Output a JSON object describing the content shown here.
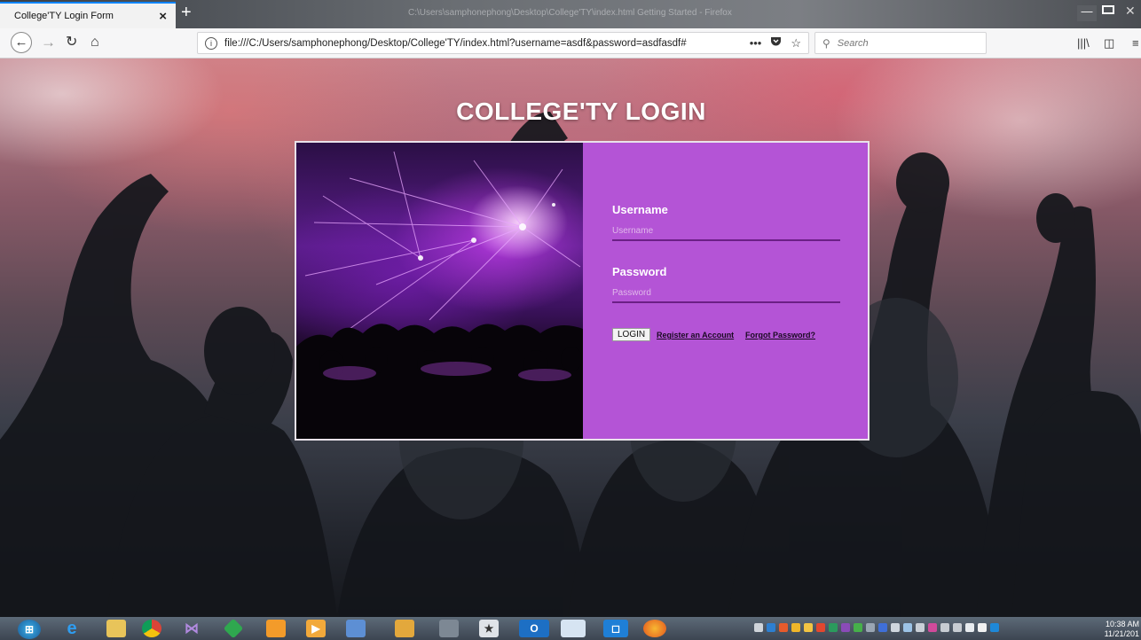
{
  "browser": {
    "tab_title": "College'TY Login Form",
    "tab_close": "×",
    "new_tab": "+",
    "window_title": "C:\\Users\\samphonephong\\Desktop\\College'TY\\index.html Getting Started - Firefox",
    "url": "file:///C:/Users/samphonephong/Desktop/College'TY/index.html?username=asdf&password=asdfasdf#",
    "url_actions": [
      "•••",
      "pocket-icon",
      "bookmark-star-icon"
    ],
    "search_placeholder": "Search",
    "nav_icons": [
      "back-arrow-icon",
      "forward-arrow-icon",
      "reload-icon",
      "home-icon"
    ],
    "tool_icons": [
      "library-icon",
      "sidebar-icon",
      "menu-icon"
    ]
  },
  "page": {
    "heading": "COLLEGE'TY LOGIN",
    "form": {
      "username_label": "Username",
      "username_placeholder": "Username",
      "password_label": "Password",
      "password_placeholder": "Password",
      "login_button": "LOGIN",
      "register_link": "Register an Account",
      "forgot_link": "Forgot Password?"
    },
    "colors": {
      "form_background": "#b454d6",
      "input_underline": "#6b1f86"
    }
  },
  "taskbar": {
    "apps": [
      "start-orb-icon",
      "ie-icon",
      "file-explorer-icon",
      "chrome-icon",
      "visual-studio-icon",
      "app-green-icon",
      "ms-office-icon",
      "media-player-icon",
      "paint-icon",
      "app-sim1-icon",
      "app-sim2-icon",
      "app-star-icon",
      "outlook-icon",
      "window-icon",
      "app-blue-icon",
      "firefox-icon"
    ],
    "clock_time": "10:38 AM",
    "clock_date": "11/21/201"
  }
}
